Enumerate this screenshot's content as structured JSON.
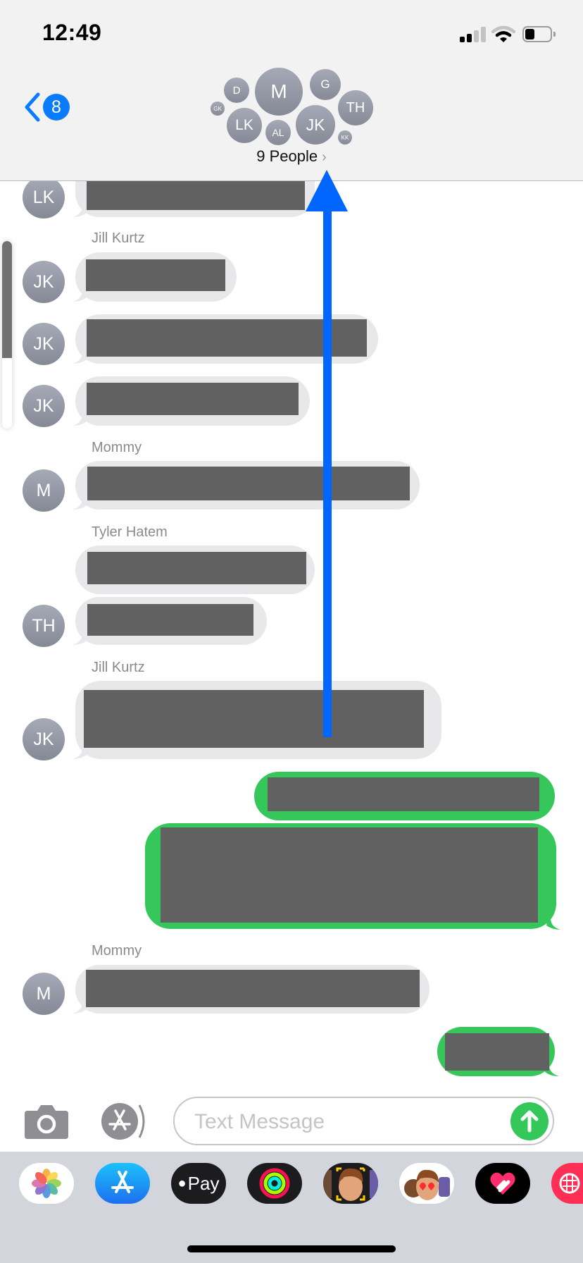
{
  "status_bar": {
    "time": "12:49",
    "signal_bars_active": 2,
    "signal_bars_total": 4,
    "battery_level_percent": 35
  },
  "header": {
    "back_badge_count": "8",
    "group_title": "9 People",
    "group_avatars": [
      {
        "initials": "D"
      },
      {
        "initials": "M"
      },
      {
        "initials": "G"
      },
      {
        "initials": "GK"
      },
      {
        "initials": "LK"
      },
      {
        "initials": "AL"
      },
      {
        "initials": "JK"
      },
      {
        "initials": "TH"
      },
      {
        "initials": "KK"
      }
    ]
  },
  "conversation": {
    "messages": [
      {
        "direction": "incoming",
        "sender_initials": "LK",
        "sender_name": "",
        "text": "[redacted]"
      },
      {
        "direction": "incoming",
        "sender_initials": "JK",
        "sender_name": "Jill Kurtz",
        "text": "[redacted]"
      },
      {
        "direction": "incoming",
        "sender_initials": "JK",
        "sender_name": "",
        "text": "[redacted]"
      },
      {
        "direction": "incoming",
        "sender_initials": "JK",
        "sender_name": "",
        "text": "[redacted]"
      },
      {
        "direction": "incoming",
        "sender_initials": "M",
        "sender_name": "Mommy",
        "text": "[redacted]"
      },
      {
        "direction": "incoming",
        "sender_initials": "TH",
        "sender_name": "Tyler Hatem",
        "text": "[redacted]"
      },
      {
        "direction": "incoming",
        "sender_initials": "TH",
        "sender_name": "",
        "text": "[redacted]"
      },
      {
        "direction": "incoming",
        "sender_initials": "JK",
        "sender_name": "Jill Kurtz",
        "text": "[redacted]"
      },
      {
        "direction": "outgoing",
        "text": "[redacted]"
      },
      {
        "direction": "outgoing",
        "text": "[redacted]"
      },
      {
        "direction": "incoming",
        "sender_initials": "M",
        "sender_name": "Mommy",
        "text": "[redacted]"
      },
      {
        "direction": "outgoing",
        "text": "[redacted]"
      }
    ],
    "scroll_position_fraction": 0.62
  },
  "annotation": {
    "type": "arrow-up",
    "color": "#0066ff"
  },
  "composer": {
    "placeholder": "Text Message",
    "camera_icon": "camera-icon",
    "apps_icon": "app-store-icon",
    "send_icon": "arrow-up-icon"
  },
  "app_drawer": {
    "apps": [
      {
        "name": "Photos"
      },
      {
        "name": "App Store"
      },
      {
        "name": "Apple Pay",
        "label": "Pay"
      },
      {
        "name": "Activity"
      },
      {
        "name": "Memoji"
      },
      {
        "name": "Memoji Stickers"
      },
      {
        "name": "Digital Touch"
      },
      {
        "name": "Images"
      }
    ]
  },
  "colors": {
    "accent": "#0a7aff",
    "outgoing_bubble": "#35c759",
    "incoming_bubble": "#e8e8ea",
    "redaction": "#616161"
  }
}
